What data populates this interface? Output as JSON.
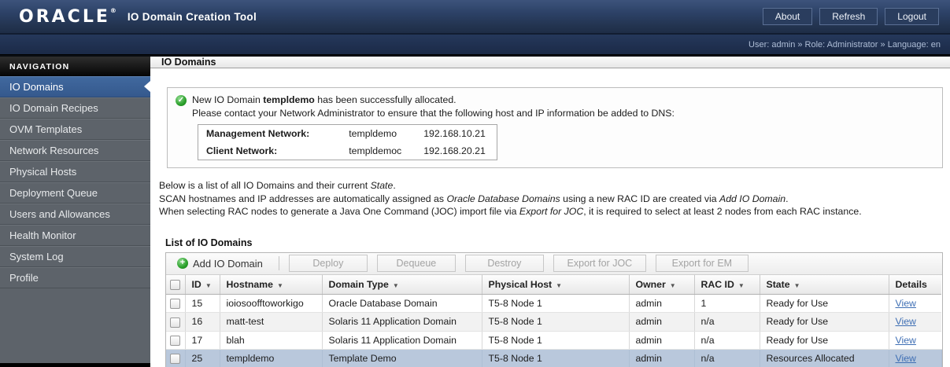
{
  "colors": {
    "header_navy": "#2c4166",
    "nav_selected_blue": "#3a639d",
    "selected_row_blue": "#b9c8dc",
    "success_green": "#2ba02b",
    "link_blue": "#3f6fb4"
  },
  "header": {
    "logo": "ORACLE",
    "logo_mark": "®",
    "app_title": "IO Domain Creation Tool",
    "buttons": [
      {
        "label": "About"
      },
      {
        "label": "Refresh"
      },
      {
        "label": "Logout"
      }
    ],
    "user_info": "User: admin » Role: Administrator » Language: en"
  },
  "sidebar": {
    "title": "NAVIGATION",
    "items": [
      {
        "label": "IO Domains",
        "selected": true
      },
      {
        "label": "IO Domain Recipes",
        "selected": false
      },
      {
        "label": "OVM Templates",
        "selected": false
      },
      {
        "label": "Network Resources",
        "selected": false
      },
      {
        "label": "Physical Hosts",
        "selected": false
      },
      {
        "label": "Deployment Queue",
        "selected": false
      },
      {
        "label": "Users and Allowances",
        "selected": false
      },
      {
        "label": "Health Monitor",
        "selected": false
      },
      {
        "label": "System Log",
        "selected": false
      },
      {
        "label": "Profile",
        "selected": false
      }
    ]
  },
  "page": {
    "title": "IO Domains"
  },
  "alert": {
    "icon": "success-check",
    "check_glyph": "✓",
    "line1_pre": "New IO Domain ",
    "line1_bold": "templdemo",
    "line1_post": " has been successfully allocated.",
    "line2": "Please contact your Network Administrator to ensure that the following host and IP information be added to DNS:",
    "dns_rows": [
      {
        "label": "Management Network:",
        "hostname": "templdemo",
        "ip": "192.168.10.21"
      },
      {
        "label": "Client Network:",
        "hostname": "templdemoc",
        "ip": "192.168.20.21"
      }
    ]
  },
  "intro": {
    "l1a": "Below is a list of all IO Domains and their current ",
    "l1b": "State",
    "l1c": ".",
    "l2a": "SCAN hostnames and IP addresses are automatically assigned as ",
    "l2b": "Oracle Database Domains",
    "l2c": " using a new RAC ID are created via ",
    "l2d": "Add IO Domain",
    "l2e": ".",
    "l3a": "When selecting RAC nodes to generate a Java One Command (JOC) import file via ",
    "l3b": "Export for JOC",
    "l3c": ", it is required to select at least 2 nodes from each RAC instance."
  },
  "list": {
    "heading": "List of IO Domains",
    "toolbar": {
      "add_label": "Add IO Domain",
      "plus_glyph": "+",
      "disabled_buttons": [
        "Deploy",
        "Dequeue",
        "Destroy",
        "Export for JOC",
        "Export for EM"
      ]
    },
    "columns": {
      "id": "ID",
      "hostname": "Hostname",
      "domain_type": "Domain Type",
      "physical_host": "Physical Host",
      "owner": "Owner",
      "rac_id": "RAC ID",
      "state": "State",
      "details": "Details"
    },
    "sort_arrow": "▼",
    "rows": [
      {
        "id": "15",
        "hostname": "ioiosoofftoworkigo",
        "domain_type": "Oracle Database Domain",
        "physical_host": "T5-8 Node 1",
        "owner": "admin",
        "rac_id": "1",
        "state": "Ready for Use",
        "details": "View",
        "selected": false
      },
      {
        "id": "16",
        "hostname": "matt-test",
        "domain_type": "Solaris 11 Application Domain",
        "physical_host": "T5-8 Node 1",
        "owner": "admin",
        "rac_id": "n/a",
        "state": "Ready for Use",
        "details": "View",
        "selected": false
      },
      {
        "id": "17",
        "hostname": "blah",
        "domain_type": "Solaris 11 Application Domain",
        "physical_host": "T5-8 Node 1",
        "owner": "admin",
        "rac_id": "n/a",
        "state": "Ready for Use",
        "details": "View",
        "selected": false
      },
      {
        "id": "25",
        "hostname": "templdemo",
        "domain_type": "Template Demo",
        "physical_host": "T5-8 Node 1",
        "owner": "admin",
        "rac_id": "n/a",
        "state": "Resources Allocated",
        "details": "View",
        "selected": true
      }
    ]
  }
}
